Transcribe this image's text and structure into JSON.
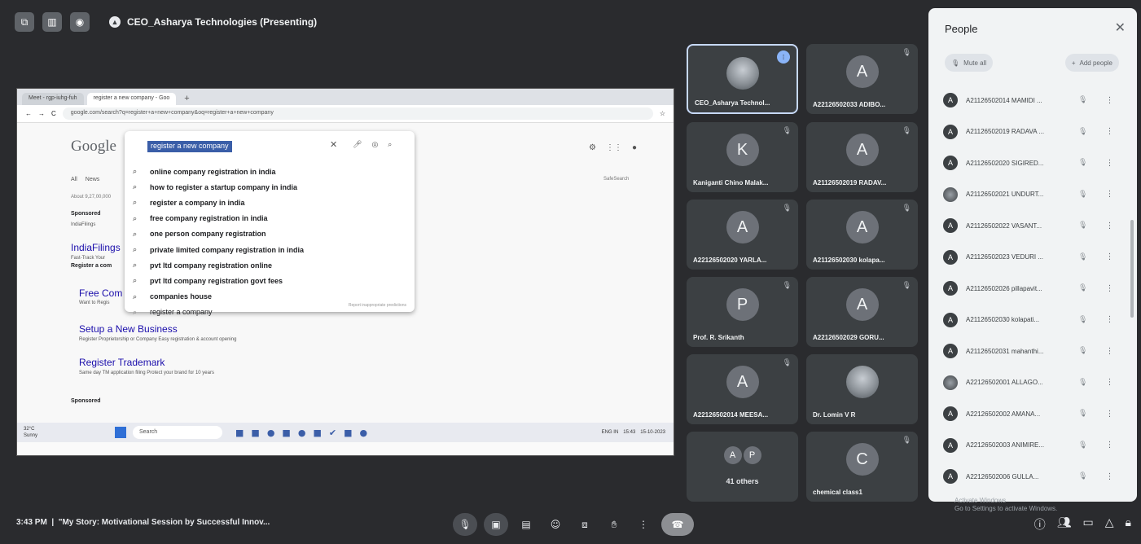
{
  "topbar": {
    "presenter_title": "CEO_Asharya Technologies (Presenting)",
    "icons": [
      "picture-in-picture-icon",
      "layout-icon",
      "record-icon",
      "presenting-icon"
    ]
  },
  "shared_screen": {
    "browser_tabs": [
      "Meet - rgp-iuhg-fuh",
      "register a new company - Goo"
    ],
    "address": "google.com/search?q=register+a+new+company&oq=register+a+new+company",
    "google_logo": "Google",
    "search_query": "register a new company",
    "suggestions": [
      "online company registration in india",
      "how to register a startup company in india",
      "register a company in india",
      "free company registration in india",
      "one person company registration",
      "private limited company registration in india",
      "pvt ltd company registration online",
      "pvt ltd company registration govt fees",
      "companies house",
      "register a company"
    ],
    "report_text": "Report inappropriate predictions",
    "safesearch": "SafeSearch",
    "tabs": [
      "All",
      "News"
    ],
    "about": "About 9,27,00,000",
    "sponsored": "Sponsored",
    "indiafilings_small": "IndiaFilings",
    "indiafilings": "IndiaFilings",
    "fast_track": "Fast-Track Your",
    "register_small": "Register a com",
    "free_com": "Free Com",
    "want_reg": "Want to Regis",
    "setup_title": "Setup a New Business",
    "setup_desc": "Register Proprietorship or Company Easy registration & account opening",
    "regtm_title": "Register Trademark",
    "regtm_desc": "Same day TM application filing Protect your brand for 10 years",
    "sponsored2": "Sponsored",
    "taskbar": {
      "weather": "32°C Sunny",
      "search": "Search",
      "lang": "ENG IN",
      "time": "15:43",
      "date": "15-10-2023"
    }
  },
  "tiles": [
    {
      "name": "CEO_Asharya Technol...",
      "initial": "",
      "photo": true,
      "speaking": true
    },
    {
      "name": "A22126502033 ADIBO...",
      "initial": "A"
    },
    {
      "name": "Kaniganti Chino Malak...",
      "initial": "K"
    },
    {
      "name": "A21126502019 RADAV...",
      "initial": "A"
    },
    {
      "name": "A22126502020 YARLA...",
      "initial": "A"
    },
    {
      "name": "A21126502030 kolapa...",
      "initial": "A"
    },
    {
      "name": "Prof. R. Srikanth",
      "initial": "P"
    },
    {
      "name": "A22126502029 GORU...",
      "initial": "A"
    },
    {
      "name": "A22126502014 MEESA...",
      "initial": "A"
    },
    {
      "name": "Dr. Lomin V R",
      "initial": "",
      "photo": true
    },
    {
      "others_label": "41 others",
      "initials": [
        "A",
        "P"
      ]
    },
    {
      "name": "chemical class1",
      "initial": "C"
    }
  ],
  "people_panel": {
    "title": "People",
    "mute_all": "Mute all",
    "add_people": "Add people",
    "participants": [
      {
        "name": "A21126502014 MAMIDI ...",
        "initial": "A"
      },
      {
        "name": "A21126502019 RADAVA ...",
        "initial": "A"
      },
      {
        "name": "A21126502020 SIGIRED...",
        "initial": "A"
      },
      {
        "name": "A21126502021 UNDURT...",
        "initial": "",
        "photo": true
      },
      {
        "name": "A21126502022 VASANT...",
        "initial": "A"
      },
      {
        "name": "A21126502023 VEDURI ...",
        "initial": "A"
      },
      {
        "name": "A21126502026 pillapavit...",
        "initial": "A"
      },
      {
        "name": "A21126502030 kolapati...",
        "initial": "A"
      },
      {
        "name": "A21126502031 mahanthi...",
        "initial": "A"
      },
      {
        "name": "A22126502001 ALLAGO...",
        "initial": "",
        "photo": true
      },
      {
        "name": "A22126502002 AMANA...",
        "initial": "A"
      },
      {
        "name": "A22126502003 ANIMIRE...",
        "initial": "A"
      },
      {
        "name": "A22126502006 GULLA...",
        "initial": "A"
      }
    ],
    "watermark": [
      "Activate Windows",
      "Go to Settings to activate Windows."
    ]
  },
  "bottom_bar": {
    "time": "3:43 PM",
    "meeting_title": "\"My Story: Motivational Session by Successful Innov..."
  }
}
